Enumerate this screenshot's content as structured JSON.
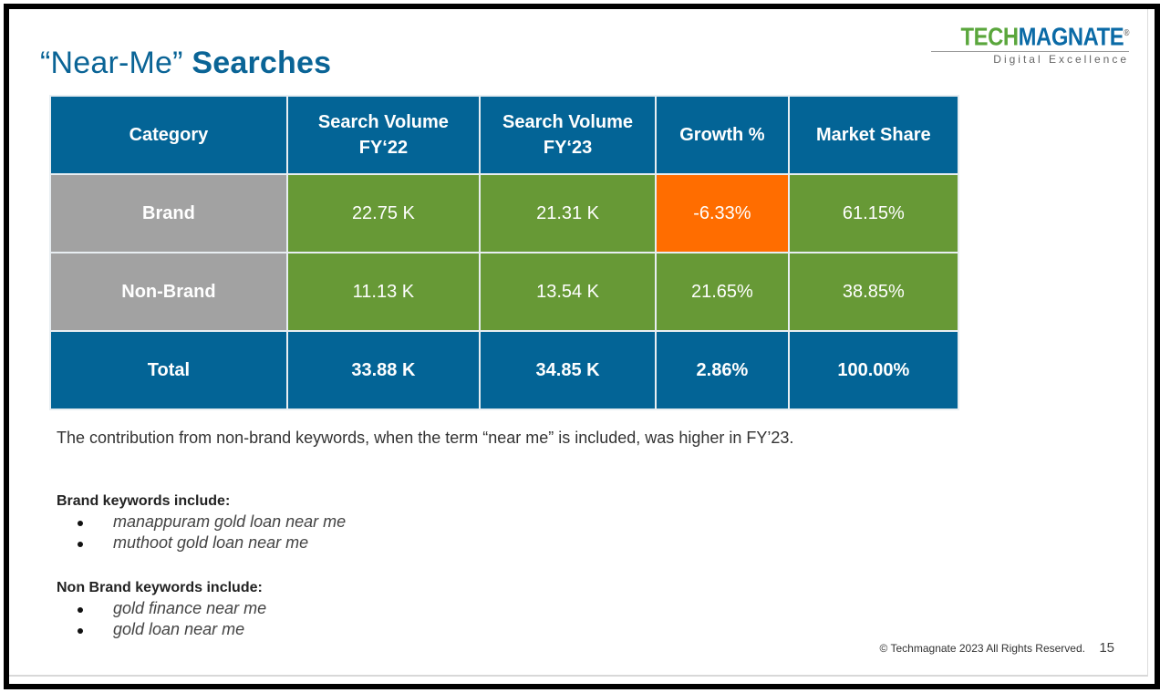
{
  "title": {
    "regular": "“Near-Me”",
    "bold": "Searches"
  },
  "logo": {
    "part1": "TECH",
    "part2": "MAGNATE",
    "mark": "®",
    "tagline": "Digital Excellence"
  },
  "colors": {
    "header_blue": "#036496",
    "category_gray": "#a2a2a2",
    "positive_green": "#679936",
    "negative_orange": "#ff6d00"
  },
  "table": {
    "headers": [
      {
        "line1": "Category",
        "line2": ""
      },
      {
        "line1": "Search Volume",
        "line2": "FY‘22"
      },
      {
        "line1": "Search Volume",
        "line2": "FY‘23"
      },
      {
        "line1": "Growth %",
        "line2": ""
      },
      {
        "line1": "Market Share",
        "line2": ""
      }
    ],
    "rows": [
      {
        "category": "Brand",
        "fy22": "22.75 K",
        "fy23": "21.31 K",
        "growth": "-6.33%",
        "share": "61.15%"
      },
      {
        "category": "Non-Brand",
        "fy22": "11.13 K",
        "fy23": "13.54 K",
        "growth": "21.65%",
        "share": "38.85%"
      }
    ],
    "total": {
      "category": "Total",
      "fy22": "33.88 K",
      "fy23": "34.85 K",
      "growth": "2.86%",
      "share": "100.00%"
    }
  },
  "note": "The contribution from non-brand keywords, when the term “near me” is included, was higher in FY’23.",
  "brand_keywords": {
    "heading": "Brand keywords include:",
    "items": [
      "manappuram gold loan near me",
      "muthoot gold loan near me"
    ]
  },
  "nonbrand_keywords": {
    "heading": "Non Brand keywords include:",
    "items": [
      "gold finance near me",
      "gold loan near me"
    ]
  },
  "footer": {
    "copyright": "© Techmagnate 2023 All Rights Reserved.",
    "page": "15"
  }
}
